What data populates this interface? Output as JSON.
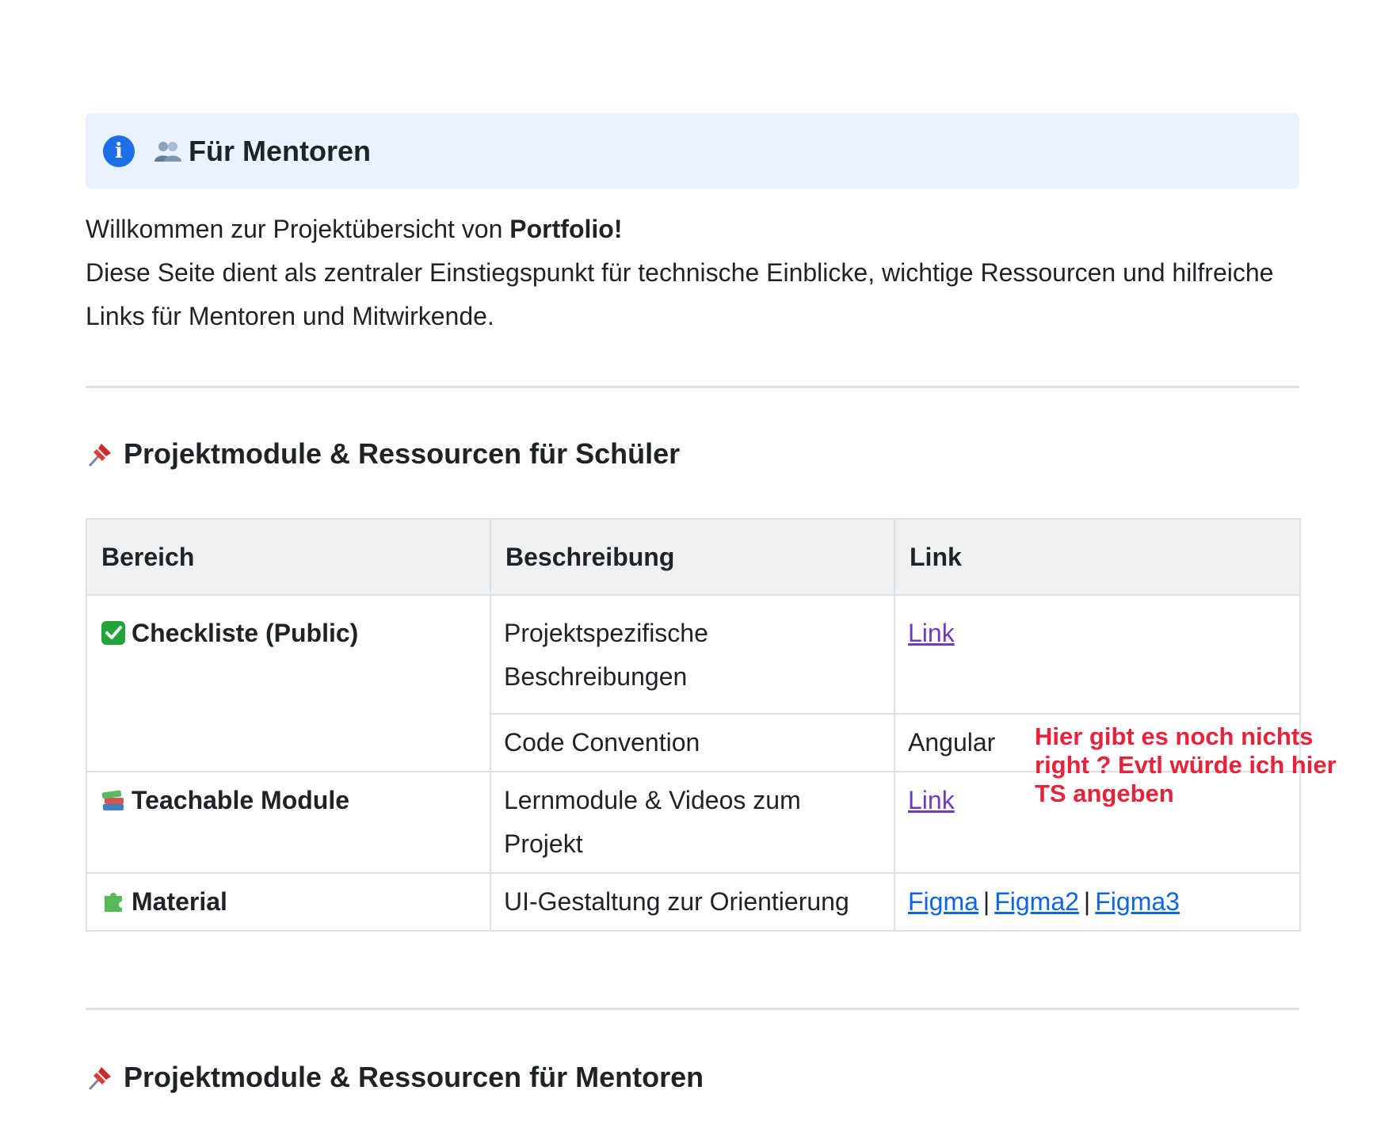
{
  "info_panel": {
    "title": "Für Mentoren",
    "info_icon": "info-icon",
    "people_icon": "people-icon"
  },
  "intro": {
    "line1_prefix": "Willkommen zur Projektübersicht von ",
    "line1_bold": "Portfolio!",
    "line2": "Diese Seite dient als zentraler Einstiegspunkt für technische Einblicke, wichtige Ressourcen und hilfreiche Links für Mentoren und Mitwirkende."
  },
  "section1": {
    "heading": "Projektmodule & Ressourcen für Schüler",
    "icon": "pushpin-icon"
  },
  "table": {
    "headers": [
      "Bereich",
      "Beschreibung",
      "Link"
    ],
    "rows": [
      {
        "category": "Checkliste (Public)",
        "category_icon": "checkmark-icon",
        "description": "Projektspezifische Beschreibungen",
        "link": "Link"
      },
      {
        "description": "Code Convention",
        "link_text": "Angular"
      },
      {
        "category": "Teachable Module",
        "category_icon": "books-icon",
        "description": "Lernmodule & Videos zum Projekt",
        "link": "Link"
      },
      {
        "category": "Material",
        "category_icon": "puzzle-icon",
        "description": "UI-Gestaltung zur Orientierung",
        "links": [
          "Figma",
          "Figma2",
          "Figma3"
        ],
        "separator": "|"
      }
    ]
  },
  "annotation": {
    "text": "Hier gibt es noch nichts right ? Evtl würde ich hier TS angeben",
    "color": "#e5243b"
  },
  "section2": {
    "heading": "Projektmodule & Ressourcen für Mentoren",
    "icon": "pushpin-icon"
  },
  "colors": {
    "panel_bg": "#e9f2ff",
    "info_icon": "#1d6ee8",
    "link": "#0c66e4",
    "visited_link": "#6e3dbd",
    "header_bg": "#f0f1f3"
  }
}
